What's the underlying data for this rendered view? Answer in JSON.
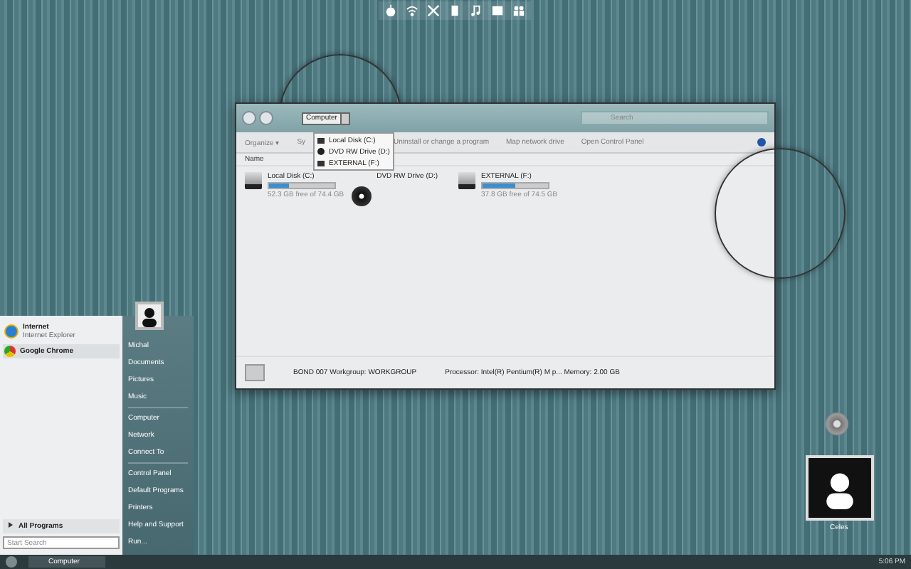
{
  "explorer": {
    "address": "Computer",
    "search": {
      "placeholder": "Search"
    },
    "address_menu": [
      {
        "label": "Local Disk (C:)",
        "kind": "disk"
      },
      {
        "label": "DVD RW Drive (D:)",
        "kind": "dvd"
      },
      {
        "label": "EXTERNAL (F:)",
        "kind": "disk"
      }
    ],
    "toolbar": [
      "Organize ▾",
      "Sy",
      "Uninstall or change a program",
      "Map network drive",
      "Open Control Panel"
    ],
    "column": "Name",
    "drives": [
      {
        "name": "Local Disk (C:)",
        "kind": "disk",
        "level": 0.3,
        "free": "52.3 GB free of 74.4 GB"
      },
      {
        "name": "DVD RW Drive (D:)",
        "kind": "dvd"
      },
      {
        "name": "EXTERNAL (F:)",
        "kind": "disk",
        "level": 0.5,
        "free": "37.8 GB free of 74.5 GB"
      }
    ],
    "status": [
      "BOND 007  Workgroup: WORKGROUP",
      "Processor: Intel(R) Pentium(R) M p...  Memory: 2.00 GB"
    ]
  },
  "start_menu": {
    "pinned": [
      {
        "title": "Internet",
        "subtitle": "Internet Explorer",
        "kind": "ie"
      },
      {
        "title": "Google Chrome",
        "kind": "chrome"
      }
    ],
    "all_programs": "All Programs",
    "search": {
      "placeholder": "Start Search"
    },
    "places": [
      [
        "Michal",
        "Documents",
        "Pictures",
        "Music"
      ],
      [
        "Computer",
        "Network",
        "Connect To"
      ],
      [
        "Control Panel",
        "Default Programs",
        "Printers",
        "Help and Support",
        "Run..."
      ]
    ]
  },
  "taskbar": {
    "tasks": [
      "Computer"
    ],
    "clock": "5:06 PM"
  },
  "desktop": {
    "user_label": "Celes"
  }
}
